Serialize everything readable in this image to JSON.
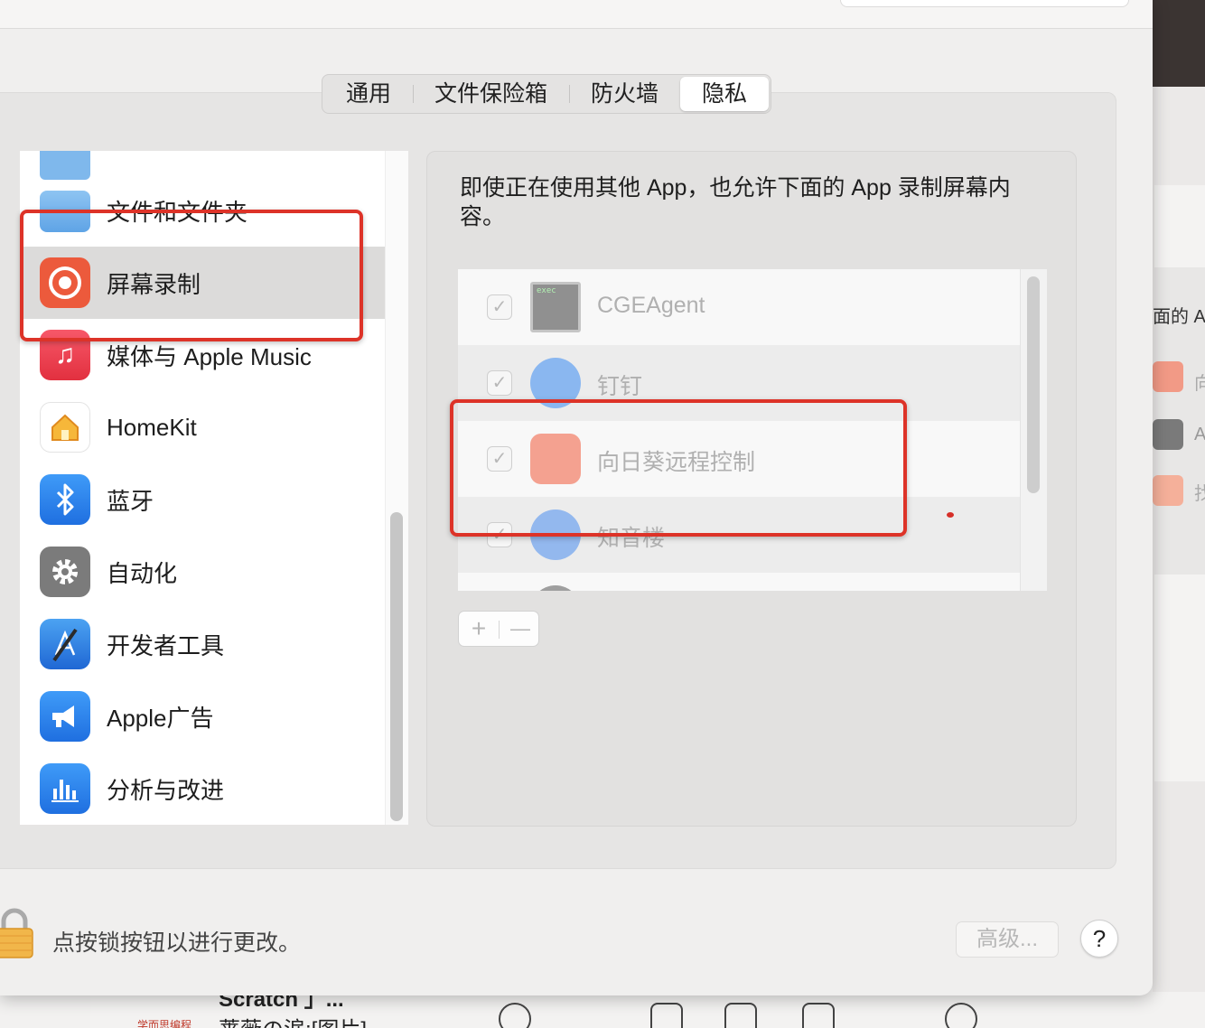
{
  "tabs": [
    "通用",
    "文件保险箱",
    "防火墙",
    "隐私"
  ],
  "active_tab": "隐私",
  "categories": [
    {
      "label": "文件和文件夹",
      "icon": "folder-icon"
    },
    {
      "label": "屏幕录制",
      "icon": "screen-record-icon",
      "selected": true
    },
    {
      "label": "媒体与 Apple Music",
      "icon": "music-icon"
    },
    {
      "label": "HomeKit",
      "icon": "home-icon"
    },
    {
      "label": "蓝牙",
      "icon": "bluetooth-icon"
    },
    {
      "label": "自动化",
      "icon": "gear-icon"
    },
    {
      "label": "开发者工具",
      "icon": "developer-tools-icon"
    },
    {
      "label": "Apple广告",
      "icon": "megaphone-icon"
    },
    {
      "label": "分析与改进",
      "icon": "chart-bars-icon"
    }
  ],
  "panel": {
    "description": "即使正在使用其他 App，也允许下面的 App 录制屏幕内容。",
    "apps": [
      {
        "name": "CGEAgent",
        "icon": "exec-icon",
        "icon_text": "exec",
        "checked": true
      },
      {
        "name": "钉钉",
        "icon": "dingtalk-icon",
        "checked": true
      },
      {
        "name": "向日葵远程控制",
        "icon": "sunlogin-icon",
        "checked": true
      },
      {
        "name": "知音楼",
        "icon": "zhiyinlou-icon",
        "checked": true
      }
    ],
    "add_label": "+",
    "remove_label": "—"
  },
  "footer": {
    "lock_text": "点按锁按钮以进行更改。",
    "advanced_label": "高级...",
    "help_label": "?"
  },
  "background": {
    "right_label_1": "面的 Ap",
    "right_label_2": "向",
    "right_label_3": "A",
    "right_label_4": "找",
    "strip_title": "Scratch 」...",
    "strip_subtitle": "蔷薇の涙:[图片]",
    "strip_logo": "学而思编程"
  },
  "colors": {
    "annotation_red": "#dd3328",
    "selected_row": "#dcdbda"
  }
}
